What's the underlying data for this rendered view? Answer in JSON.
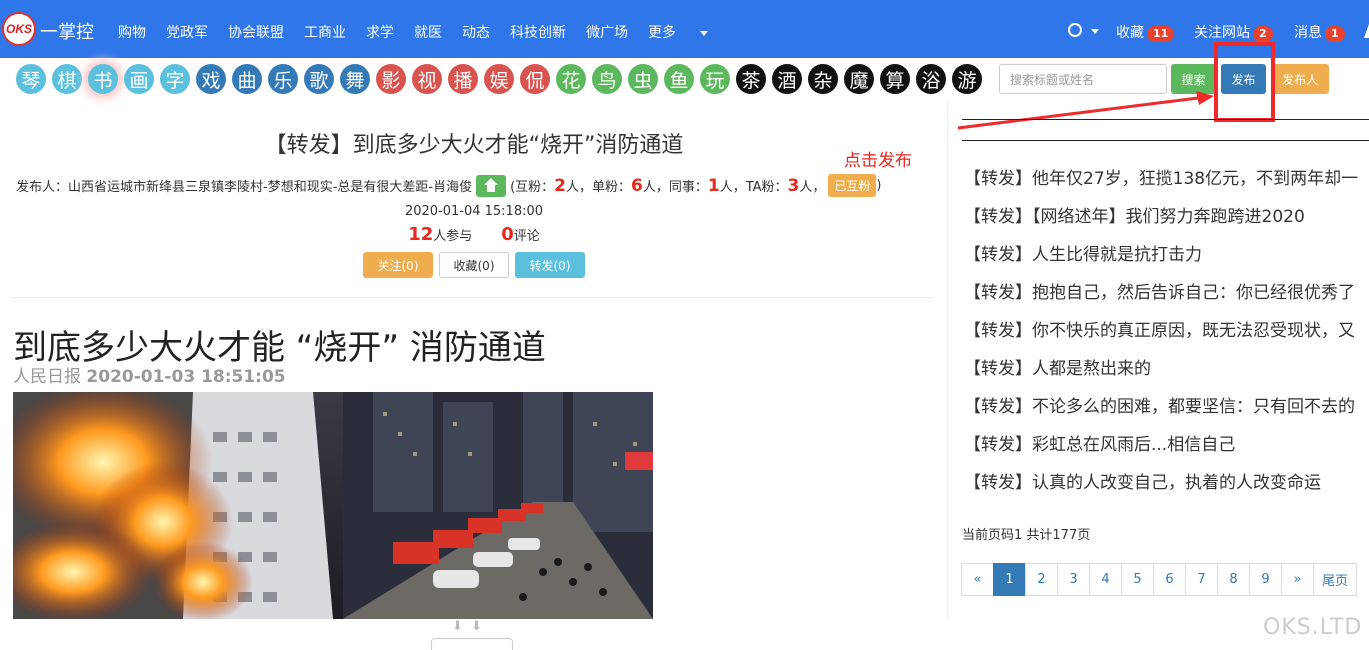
{
  "nav": {
    "logo_text": "OKS",
    "brand": "一掌控",
    "items": [
      "购物",
      "党政军",
      "协会联盟",
      "工商业",
      "求学",
      "就医",
      "动态",
      "科技创新",
      "微广场"
    ],
    "more": "更多",
    "favorites": {
      "label": "收藏",
      "count": "11"
    },
    "followed": {
      "label": "关注网站",
      "count": "2"
    },
    "messages": {
      "label": "消息",
      "count": "1"
    }
  },
  "categories": [
    {
      "label": "琴",
      "color": "#5bc0de"
    },
    {
      "label": "棋",
      "color": "#5bc0de"
    },
    {
      "label": "书",
      "color": "#5bc0de"
    },
    {
      "label": "画",
      "color": "#5bc0de"
    },
    {
      "label": "字",
      "color": "#5bc0de"
    },
    {
      "label": "戏",
      "color": "#337ab7"
    },
    {
      "label": "曲",
      "color": "#337ab7"
    },
    {
      "label": "乐",
      "color": "#337ab7"
    },
    {
      "label": "歌",
      "color": "#337ab7"
    },
    {
      "label": "舞",
      "color": "#337ab7"
    },
    {
      "label": "影",
      "color": "#d9534f"
    },
    {
      "label": "视",
      "color": "#d9534f"
    },
    {
      "label": "播",
      "color": "#d9534f"
    },
    {
      "label": "娱",
      "color": "#d9534f"
    },
    {
      "label": "侃",
      "color": "#d9534f"
    },
    {
      "label": "花",
      "color": "#5cb85c"
    },
    {
      "label": "鸟",
      "color": "#5cb85c"
    },
    {
      "label": "虫",
      "color": "#5cb85c"
    },
    {
      "label": "鱼",
      "color": "#5cb85c"
    },
    {
      "label": "玩",
      "color": "#5cb85c"
    },
    {
      "label": "茶",
      "color": "#111111"
    },
    {
      "label": "酒",
      "color": "#111111"
    },
    {
      "label": "杂",
      "color": "#111111"
    },
    {
      "label": "魔",
      "color": "#111111"
    },
    {
      "label": "算",
      "color": "#111111"
    },
    {
      "label": "浴",
      "color": "#111111"
    },
    {
      "label": "游",
      "color": "#111111"
    }
  ],
  "selected_category": "书",
  "search": {
    "placeholder": "搜索标题或姓名",
    "button": "搜索"
  },
  "publish_button": "发布",
  "publisher_button": "发布人",
  "annotation": "点击发布",
  "post": {
    "title": "【转发】到底多少大火才能“烧开”消防通道",
    "publisher_prefix": "发布人：山西省运城市新绛县三泉镇李陵村-梦想和现实-总是有很大差距-肖海俊",
    "mutual_label": "(互粉：",
    "mutual": "2",
    "single_label": "人，单粉：",
    "single": "6",
    "colleague_label": "人，同事：",
    "colleague": "1",
    "ta_label": "人，TA粉：",
    "ta": "3",
    "ta_suffix": "人，",
    "already_mutual": "已互粉",
    "close_paren": ")",
    "datetime": "2020-01-04 15:18:00",
    "participants": "12",
    "participants_label": "人参与",
    "comments": "0",
    "comments_label": "评论",
    "follow_btn": "关注(0)",
    "collect_btn": "收藏(0)",
    "forward_btn": "转发(0)"
  },
  "article": {
    "headline": "到底多少大火才能 “烧开” 消防通道",
    "source": "人民日报",
    "time": "2020-01-03 18:51:05"
  },
  "sidebar": {
    "items": [
      "【转发】他年仅27岁，狂揽138亿元，不到两年却一",
      "【转发】【网络述年】我们努力奔跑跨进2020",
      "【转发】人生比得就是抗打击力",
      "【转发】抱抱自己，然后告诉自己：你已经很优秀了",
      "【转发】你不快乐的真正原因，既无法忍受现状，又",
      "【转发】人都是熬出来的",
      "【转发】不论多么的困难，都要坚信：只有回不去的",
      "【转发】彩虹总在风雨后...相信自己",
      "【转发】认真的人改变自己，执着的人改变命运"
    ],
    "page_info": "当前页码1 共计177页",
    "pager": [
      "«",
      "1",
      "2",
      "3",
      "4",
      "5",
      "6",
      "7",
      "8",
      "9",
      "»",
      "尾页"
    ],
    "active_page": "1"
  },
  "watermark": "OKS.LTD",
  "colors": {
    "nav": "#2f76e8",
    "highlight": "#f02a2a",
    "badge": "#e8412d"
  }
}
